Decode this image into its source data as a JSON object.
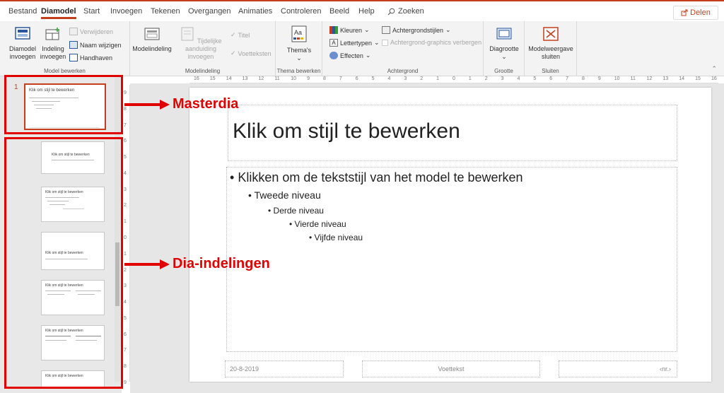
{
  "tabs": [
    {
      "label": "Bestand",
      "active": false
    },
    {
      "label": "Diamodel",
      "active": true
    },
    {
      "label": "Start",
      "active": false
    },
    {
      "label": "Invoegen",
      "active": false
    },
    {
      "label": "Tekenen",
      "active": false
    },
    {
      "label": "Overgangen",
      "active": false
    },
    {
      "label": "Animaties",
      "active": false
    },
    {
      "label": "Controleren",
      "active": false
    },
    {
      "label": "Beeld",
      "active": false
    },
    {
      "label": "Help",
      "active": false
    }
  ],
  "search": {
    "label": "Zoeken",
    "icon": "search-icon"
  },
  "share": {
    "label": "Delen",
    "icon": "share-icon",
    "color": "#c43e1c"
  },
  "ribbon": {
    "model_bewerken": {
      "label": "Model bewerken",
      "diamodel_invoegen": "Diamodel invoegen",
      "indeling_invoegen": "Indeling invoegen",
      "verwijderen": "Verwijderen",
      "naam_wijzigen": "Naam wijzigen",
      "handhaven": "Handhaven"
    },
    "modelindeling": {
      "label": "Modelindeling",
      "modelindeling": "Modelindeling",
      "tijdelijke": "Tijdelijke aanduiding invoegen",
      "titel": "Titel",
      "voetteksten": "Voetteksten"
    },
    "thema_bewerken": {
      "label": "Thema bewerken",
      "themas": "Thema's"
    },
    "achtergrond": {
      "label": "Achtergrond",
      "kleuren": "Kleuren",
      "lettertypen": "Lettertypen",
      "effecten": "Effecten",
      "achtergrondstijlen": "Achtergrondstijlen",
      "graphics_verbergen": "Achtergrond-graphics verbergen"
    },
    "grootte": {
      "label": "Grootte",
      "diagrootte": "Diagrootte"
    },
    "sluiten": {
      "label": "Sluiten",
      "modelweergave_sluiten": "Modelweergave sluiten"
    }
  },
  "slide_pane": {
    "first_number": "1",
    "thumbnail_titles": [
      "Klik om stijl te bewerken",
      "Klik om stijl te bewerken",
      "Klik om stijl te bewerken",
      "Klik om stijl te bewerken",
      "Klik om stijl te bewerken",
      "Klik om stijl te bewerken",
      "Klik om stijl te bewerken"
    ]
  },
  "ruler": {
    "horizontal": [
      "16",
      "15",
      "14",
      "13",
      "12",
      "11",
      "10",
      "9",
      "8",
      "7",
      "6",
      "5",
      "4",
      "3",
      "2",
      "1",
      "0",
      "1",
      "2",
      "3",
      "4",
      "5",
      "6",
      "7",
      "8",
      "9",
      "10",
      "11",
      "12",
      "13",
      "14",
      "15",
      "16"
    ],
    "vertical": [
      "9",
      "8",
      "7",
      "6",
      "5",
      "4",
      "3",
      "2",
      "1",
      "0",
      "1",
      "2",
      "3",
      "4",
      "5",
      "6",
      "7",
      "8",
      "9"
    ]
  },
  "slide": {
    "title": "Klik om stijl te bewerken",
    "levels": [
      "Klikken om de tekststijl van het model te bewerken",
      "Tweede niveau",
      "Derde niveau",
      "Vierde niveau",
      "Vijfde niveau"
    ],
    "footer_date": "20-8-2019",
    "footer_text": "Voettekst",
    "footer_number": "‹nr.›"
  },
  "annotations": {
    "masterdia": "Masterdia",
    "dia_indelingen": "Dia-indelingen",
    "color": "#e00000"
  }
}
